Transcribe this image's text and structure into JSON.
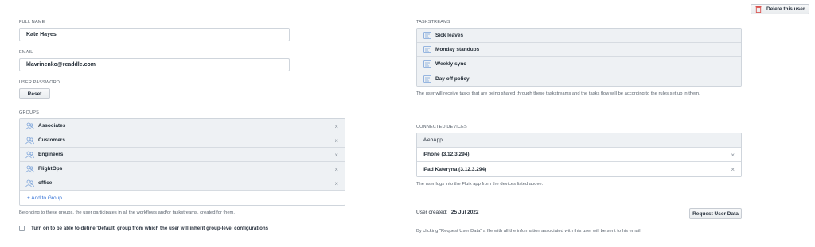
{
  "delete_button": {
    "label": "Delete this user"
  },
  "full_name": {
    "label": "FULL NAME",
    "value": "Kate Hayes"
  },
  "email": {
    "label": "EMAIL",
    "value": "klavrinenko@readdle.com"
  },
  "password": {
    "label": "USER PASSWORD",
    "reset_label": "Reset"
  },
  "groups": {
    "label": "GROUPS",
    "items": [
      {
        "name": "Associates"
      },
      {
        "name": "Customers"
      },
      {
        "name": "Engineers"
      },
      {
        "name": "FlightOps"
      },
      {
        "name": "office"
      }
    ],
    "remove_glyph": "×",
    "add_label": "+ Add to Group",
    "help": "Belonging to these groups, the user participates in all the workflows and/or taskstreams, created for them.",
    "default_toggle_label": "Turn on to be able to define 'Default' group from which the user will inherit group-level configurations"
  },
  "taskstreams": {
    "label": "TASKSTREAMS",
    "items": [
      {
        "name": "Sick leaves"
      },
      {
        "name": "Monday standups"
      },
      {
        "name": "Weekly sync"
      },
      {
        "name": "Day off policy"
      }
    ],
    "help": "The user will receive tasks that are being shared through these taskstreams and the tasks flow will be according to the rules set up in them."
  },
  "devices": {
    "label": "CONNECTED DEVICES",
    "header": "WebApp",
    "items": [
      {
        "name": "iPhone (3.12.3.294)"
      },
      {
        "name": "iPad Kateryna (3.12.3.294)"
      }
    ],
    "remove_glyph": "×",
    "help": "The user logs into the Fluix app from the devices listed above."
  },
  "user_created": {
    "label": "User created:",
    "value": "25 Jul 2022"
  },
  "request_data": {
    "button_label": "Request User Data",
    "help": "By clicking \"Request User Data\" a file with all the information associated with this user will be sent to his email."
  },
  "colors": {
    "accent": "#2f6fd6",
    "danger": "#d9534f",
    "row_bg": "#eef1f4"
  }
}
